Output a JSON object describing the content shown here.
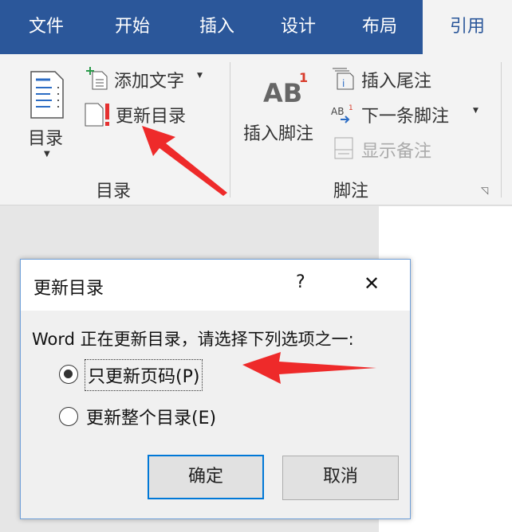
{
  "tabs": [
    "文件",
    "开始",
    "插入",
    "设计",
    "布局",
    "引用"
  ],
  "active_tab": "引用",
  "ribbon": {
    "toc_button": "目录",
    "add_text": "添加文字",
    "update_toc": "更新目录",
    "toc_group": "目录",
    "insert_footnote": "插入脚注",
    "ab_icon": "AB",
    "ab_sup": "1",
    "insert_endnote": "插入尾注",
    "next_footnote": "下一条脚注",
    "show_notes": "显示备注",
    "footnote_group": "脚注"
  },
  "dialog": {
    "title": "更新目录",
    "help": "?",
    "close": "✕",
    "prompt": "Word 正在更新目录，请选择下列选项之一:",
    "options": [
      {
        "label": "只更新页码(P)",
        "selected": true
      },
      {
        "label": "更新整个目录(E)",
        "selected": false
      }
    ],
    "ok": "确定",
    "cancel": "取消"
  },
  "colors": {
    "tabbar": "#2b579a",
    "arrow": "#ee2a2a",
    "focus": "#0078d7"
  }
}
